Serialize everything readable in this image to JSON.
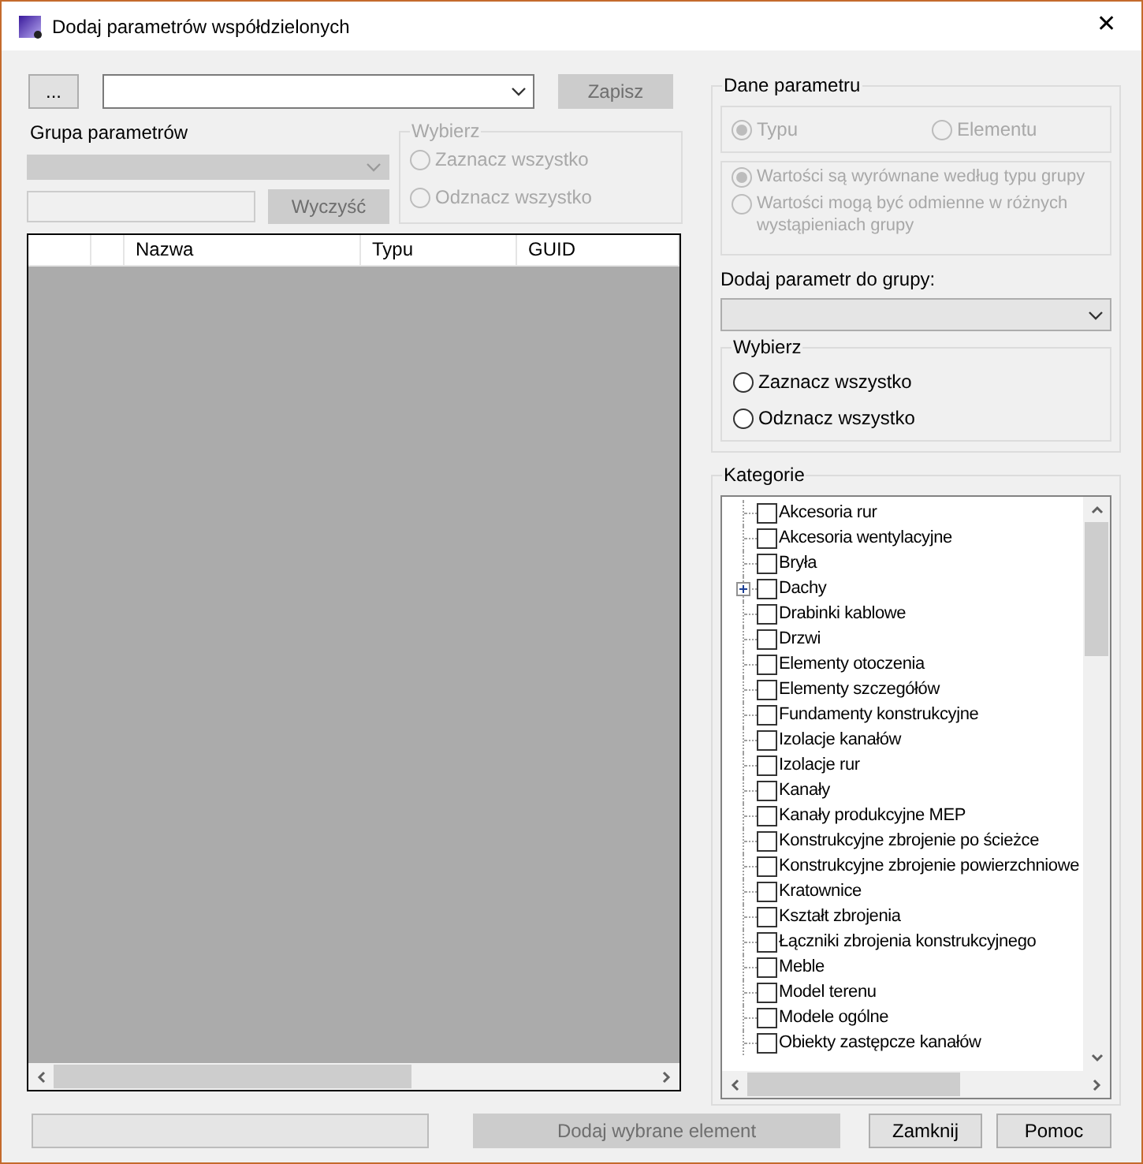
{
  "window": {
    "title": "Dodaj parametrów współdzielonych",
    "close": "✕"
  },
  "top_bar": {
    "browse_button": {
      "label": "...",
      "disabled": false
    },
    "save_button": {
      "label": "Zapisz",
      "disabled": true
    }
  },
  "group_section": {
    "label": "Grupa parametrów",
    "disabled": true,
    "clear_button": {
      "label": "Wyczyść",
      "disabled": true
    }
  },
  "left_select": {
    "title": "Wybierz",
    "disabled": true,
    "options": [
      {
        "label": "Zaznacz wszystko",
        "selected": false
      },
      {
        "label": "Odznacz wszystko",
        "selected": false
      }
    ]
  },
  "table": {
    "columns": [
      "Nazwa",
      "Typu",
      "GUID"
    ]
  },
  "parameter_data": {
    "title": "Dane parametru",
    "disabled": true,
    "binding": [
      {
        "label": "Typu",
        "selected": true
      },
      {
        "label": "Elementu",
        "selected": false
      }
    ],
    "values": [
      {
        "label": "Wartości są wyrównane według typu grupy",
        "selected": true
      },
      {
        "label": "Wartości mogą być odmienne w różnych wystąpieniach grupy",
        "selected": false
      }
    ]
  },
  "add_to_group_label": "Dodaj parametr do grupy:",
  "right_select": {
    "title": "Wybierz",
    "disabled": false,
    "options": [
      {
        "label": "Zaznacz wszystko",
        "selected": false
      },
      {
        "label": "Odznacz wszystko",
        "selected": false
      }
    ]
  },
  "categories": {
    "title": "Kategorie",
    "items": [
      {
        "label": "Akcesoria rur",
        "checked": false,
        "collapsed": false
      },
      {
        "label": "Akcesoria wentylacyjne",
        "checked": false,
        "collapsed": false
      },
      {
        "label": "Bryła",
        "checked": false,
        "collapsed": false
      },
      {
        "label": "Dachy",
        "checked": false,
        "collapsed": true
      },
      {
        "label": "Drabinki kablowe",
        "checked": false,
        "collapsed": false
      },
      {
        "label": "Drzwi",
        "checked": false,
        "collapsed": false
      },
      {
        "label": "Elementy otoczenia",
        "checked": false,
        "collapsed": false
      },
      {
        "label": "Elementy szczegółów",
        "checked": false,
        "collapsed": false
      },
      {
        "label": "Fundamenty konstrukcyjne",
        "checked": false,
        "collapsed": false
      },
      {
        "label": "Izolacje kanałów",
        "checked": false,
        "collapsed": false
      },
      {
        "label": "Izolacje rur",
        "checked": false,
        "collapsed": false
      },
      {
        "label": "Kanały",
        "checked": false,
        "collapsed": false
      },
      {
        "label": "Kanały produkcyjne MEP",
        "checked": false,
        "collapsed": false
      },
      {
        "label": "Konstrukcyjne zbrojenie po ścieżce",
        "checked": false,
        "collapsed": false
      },
      {
        "label": "Konstrukcyjne zbrojenie powierzchniowe",
        "checked": false,
        "collapsed": false
      },
      {
        "label": "Kratownice",
        "checked": false,
        "collapsed": false
      },
      {
        "label": "Kształt zbrojenia",
        "checked": false,
        "collapsed": false
      },
      {
        "label": "Łączniki zbrojenia konstrukcyjnego",
        "checked": false,
        "collapsed": false
      },
      {
        "label": "Meble",
        "checked": false,
        "collapsed": false
      },
      {
        "label": "Model terenu",
        "checked": false,
        "collapsed": false
      },
      {
        "label": "Modele ogólne",
        "checked": false,
        "collapsed": false
      },
      {
        "label": "Obiekty zastępcze kanałów",
        "checked": false,
        "collapsed": false
      }
    ]
  },
  "bottom": {
    "add_button": {
      "label": "Dodaj wybrane element",
      "disabled": true
    },
    "close_button": {
      "label": "Zamknij",
      "disabled": false
    },
    "help_button": {
      "label": "Pomoc",
      "disabled": false
    }
  }
}
